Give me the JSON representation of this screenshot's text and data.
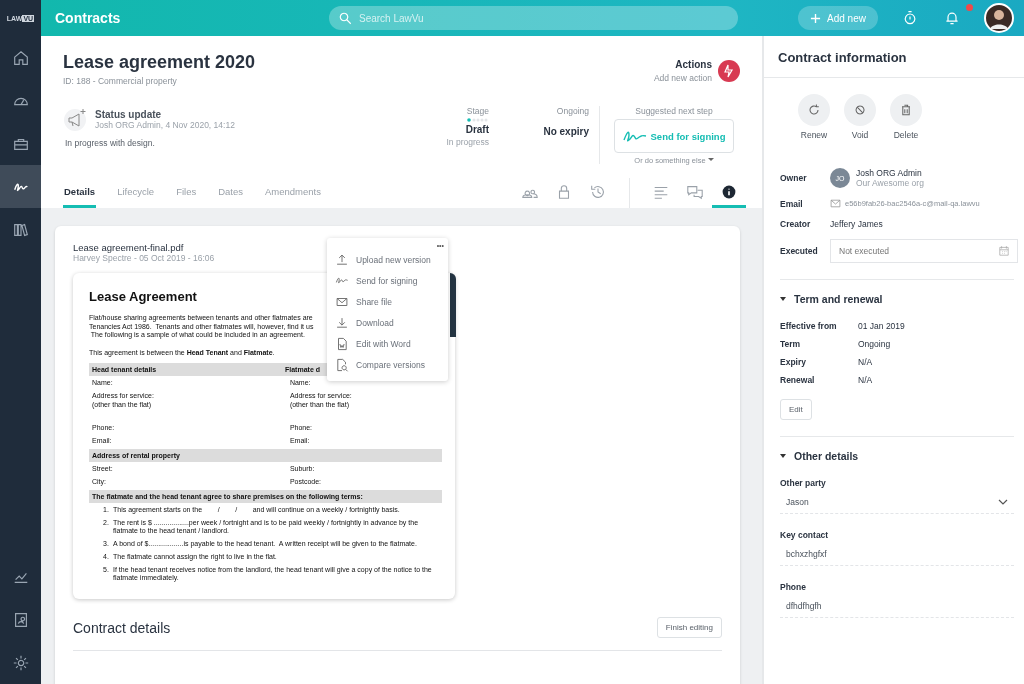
{
  "sidebar": {
    "logo": [
      "LAW",
      "VU"
    ],
    "items": [
      {
        "kind": "home",
        "selected": false
      },
      {
        "kind": "gauge",
        "selected": false
      },
      {
        "kind": "briefcase",
        "selected": false
      },
      {
        "kind": "signature",
        "selected": true
      },
      {
        "kind": "books",
        "selected": false
      }
    ],
    "bottom_items": [
      {
        "kind": "chart",
        "selected": false
      },
      {
        "kind": "contact",
        "selected": false
      },
      {
        "kind": "gear",
        "selected": false
      }
    ]
  },
  "topbar": {
    "title": "Contracts",
    "search": {
      "placeholder": "Search LawVu"
    },
    "add_button": "Add new",
    "unread_notifications": true
  },
  "header": {
    "title": "Lease agreement 2020",
    "subtitle": "ID: 188 - Commercial property",
    "actions": {
      "label": "Actions",
      "hint": "Add new action"
    },
    "status": {
      "title": "Status update",
      "meta": "Josh ORG Admin, 4 Nov 2020, 14:12",
      "text": "In progress with design."
    },
    "stage": {
      "label": "Stage",
      "value": "Draft",
      "sub": "In progress"
    },
    "expiry": {
      "label": "Ongoing",
      "value": "No expiry"
    },
    "next_step": {
      "label": "Suggested next step",
      "button": "Send for signing",
      "more": "Or do something else"
    }
  },
  "tabs": [
    {
      "label": "Details",
      "selected": true
    },
    {
      "label": "Lifecycle",
      "selected": false
    },
    {
      "label": "Files",
      "selected": false
    },
    {
      "label": "Dates",
      "selected": false
    },
    {
      "label": "Amendments",
      "selected": false
    }
  ],
  "tab_icons": [
    {
      "kind": "people",
      "selected": false
    },
    {
      "kind": "lock",
      "selected": false
    },
    {
      "kind": "history",
      "selected": false
    },
    {
      "kind": "list",
      "selected": false
    },
    {
      "kind": "comments",
      "selected": false
    },
    {
      "kind": "info",
      "selected": true
    }
  ],
  "file": {
    "name": "Lease agreement-final.pdf",
    "meta": "Harvey Spectre - 05 Oct 2019 - 16:06",
    "menu_button": "•••",
    "menu": [
      {
        "kind": "upload",
        "label": "Upload new version"
      },
      {
        "kind": "sign",
        "label": "Send for signing"
      },
      {
        "kind": "share",
        "label": "Share file"
      },
      {
        "kind": "download",
        "label": "Download"
      },
      {
        "kind": "word",
        "label": "Edit with Word"
      },
      {
        "kind": "compare",
        "label": "Compare versions"
      }
    ],
    "document": {
      "title": "Lease Agreement",
      "intro": [
        "Flat/house sharing agreements between tenants and other flatmates are",
        "Tenancies Act 1986.  Tenants and other flatmates will, however, find it us",
        " The following is a sample of what could be included in an agreement."
      ],
      "parties": "This agreement is between the **Head Tenant** and **Flatmate**.",
      "sections": [
        {
          "heading": [
            "Head tenant details",
            "Flatmate d"
          ],
          "rows": [
            {
              "left": [
                "Name:"
              ],
              "right": [
                "Name:"
              ]
            },
            {
              "left": [
                "Address for service:",
                "(other than the flat)"
              ],
              "right": [
                "Address for service:",
                "(other than the flat)"
              ]
            },
            {
              "left": [
                "Phone:"
              ],
              "right": [
                "Phone:"
              ]
            },
            {
              "left": [
                "Email:"
              ],
              "right": [
                "Email:"
              ]
            }
          ]
        },
        {
          "heading": [
            "Address of rental property"
          ],
          "rows": [
            {
              "left": [
                "Street:"
              ],
              "right": [
                "Suburb:"
              ]
            },
            {
              "left": [
                "City:"
              ],
              "right": [
                "Postcode:"
              ]
            }
          ]
        },
        {
          "heading": [
            "The flatmate and the head tenant agree to share premises on the following terms:"
          ]
        }
      ],
      "terms": [
        {
          "num": "1.",
          "text": "This agreement starts on the        /        /        and will continue on a weekly / fortnightly basis."
        },
        {
          "num": "2.",
          "text": "The rent is $ ..................per week / fortnight and is to be paid weekly / fortnightly in advance by the flatmate to the head tenant / landlord."
        },
        {
          "num": "3.",
          "text": "A bond of $..................is payable to the head tenant.  A written receipt will be given to the flatmate."
        },
        {
          "num": "4.",
          "text": "The flatmate cannot assign the right to live in the flat."
        },
        {
          "num": "5.",
          "text": "If the head tenant receives notice from the landlord, the head tenant will give a copy of the notice to the flatmate immediately."
        }
      ]
    }
  },
  "contract_details": {
    "title": "Contract details",
    "button": "Finish editing"
  },
  "info_panel": {
    "title": "Contract information",
    "actions": [
      {
        "kind": "renew",
        "label": "Renew"
      },
      {
        "kind": "void",
        "label": "Void"
      },
      {
        "kind": "delete",
        "label": "Delete"
      }
    ],
    "owner": {
      "label": "Owner",
      "initials": "JO",
      "name": "Josh ORG Admin",
      "org": "Our Awesome org"
    },
    "email": {
      "label": "Email",
      "value": "e56b9fab26-bac2546a-c@mail-qa.lawvu"
    },
    "creator": {
      "label": "Creator",
      "value": "Jeffery James"
    },
    "executed": {
      "label": "Executed",
      "placeholder": "Not executed"
    },
    "sections": [
      {
        "title": "Term and renewal",
        "expanded": true,
        "rows": [
          {
            "label": "Effective from",
            "value": "01 Jan 2019"
          },
          {
            "label": "Term",
            "value": "Ongoing"
          },
          {
            "label": "Expiry",
            "value": "N/A"
          },
          {
            "label": "Renewal",
            "value": "N/A"
          }
        ],
        "button": "Edit"
      },
      {
        "title": "Other details",
        "expanded": true,
        "fields": [
          {
            "kind": "select",
            "label": "Other party",
            "value": "Jason"
          },
          {
            "kind": "text",
            "label": "Key contact",
            "value": "bchxzhgfxf"
          },
          {
            "kind": "text",
            "label": "Phone",
            "value": "dfhdfhgfh"
          }
        ]
      }
    ]
  }
}
